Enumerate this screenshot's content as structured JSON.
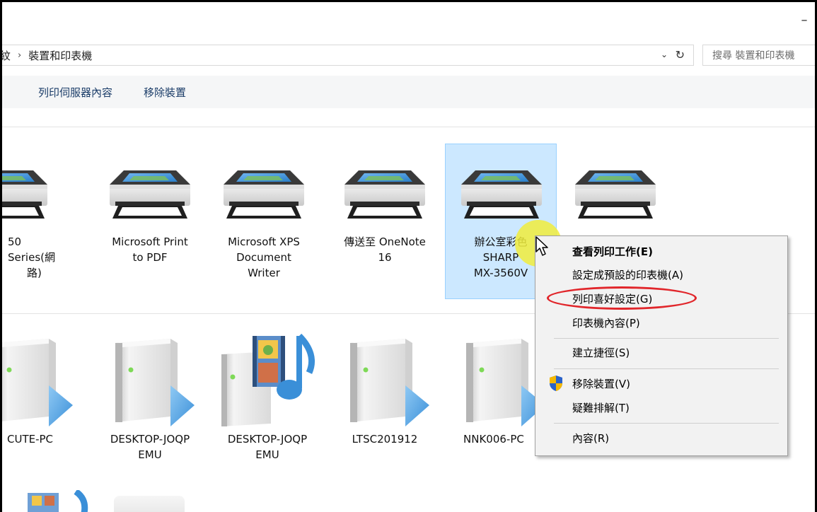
{
  "window": {
    "minimize_glyph": "–"
  },
  "address": {
    "truncated_crumb": "紋",
    "separator": "›",
    "current": "裝置和印表機",
    "dropdown_glyph": "⌄",
    "refresh_glyph": "↻",
    "search_placeholder": "搜尋 裝置和印表機"
  },
  "toolbar": {
    "print_server_properties": "列印伺服器內容",
    "remove_device": "移除裝置"
  },
  "printers": [
    {
      "label": "50 Series(網路)",
      "label_lines": [
        "50 Series(網",
        "路)"
      ]
    },
    {
      "label": "Microsoft Print to PDF",
      "label_lines": [
        "Microsoft Print",
        "to PDF"
      ]
    },
    {
      "label": "Microsoft XPS Document Writer",
      "label_lines": [
        "Microsoft XPS",
        "Document",
        "Writer"
      ]
    },
    {
      "label": "傳送至 OneNote 16",
      "label_lines": [
        "傳送至 OneNote",
        "16"
      ]
    },
    {
      "label": "辦公室彩色 SHARP MX-3560V",
      "label_lines": [
        "辦公室彩色",
        "SHARP",
        "MX-3560V"
      ],
      "selected": true
    },
    {
      "label": "",
      "label_lines": []
    }
  ],
  "computers": [
    {
      "label_lines": [
        "CUTE-PC"
      ],
      "type": "pc"
    },
    {
      "label_lines": [
        "DESKTOP-JOQP",
        "EMU"
      ],
      "type": "pc"
    },
    {
      "label_lines": [
        "DESKTOP-JOQP",
        "EMU"
      ],
      "type": "media"
    },
    {
      "label_lines": [
        "LTSC201912"
      ],
      "type": "pc"
    },
    {
      "label_lines": [
        "NNK006-PC"
      ],
      "type": "pc"
    }
  ],
  "context_menu": {
    "items": [
      {
        "label": "查看列印工作(E)",
        "bold": true
      },
      {
        "label": "設定成預設的印表機(A)"
      },
      {
        "label": "列印喜好設定(G)",
        "highlighted": true
      },
      {
        "label": "印表機內容(P)"
      },
      {
        "label": "建立捷徑(S)"
      },
      {
        "label": "移除裝置(V)",
        "icon": "uac-shield-icon"
      },
      {
        "label": "疑難排解(T)"
      },
      {
        "label": "內容(R)"
      }
    ]
  },
  "colors": {
    "selection_fill": "#cce8ff",
    "selection_border": "#99d1ff",
    "highlight_ellipse": "#e1262b",
    "cursor_halo": "#f0ec3c",
    "command_text": "#1a3c68"
  }
}
